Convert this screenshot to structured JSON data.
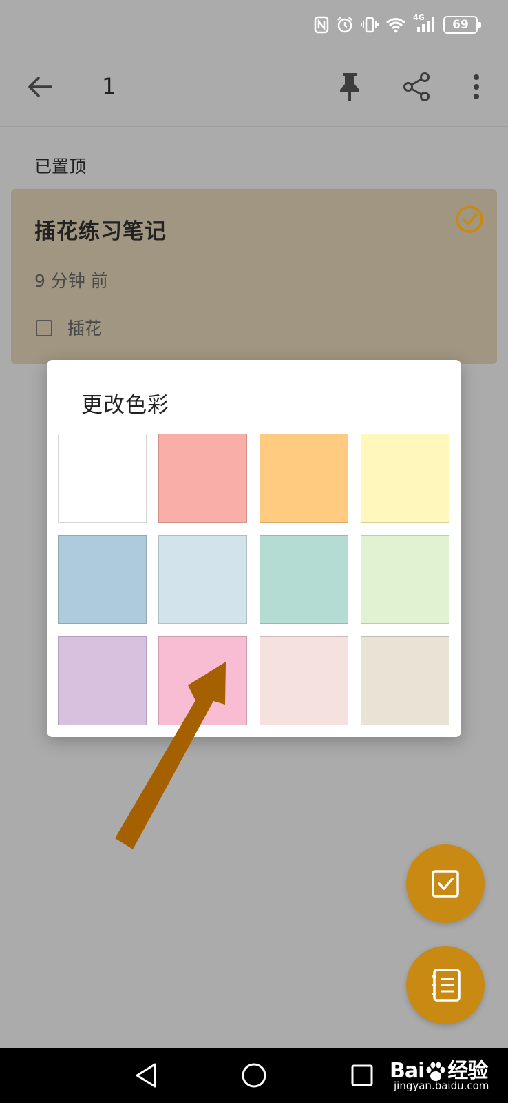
{
  "status_bar": {
    "battery_level": "69",
    "network_type": "4G",
    "icons": [
      "nfc-icon",
      "alarm-icon",
      "vibrate-icon",
      "wifi-icon",
      "signal-icon",
      "battery-icon"
    ]
  },
  "header": {
    "title": "1",
    "icons": [
      "back-arrow-icon",
      "pin-icon",
      "share-icon",
      "more-vertical-icon"
    ]
  },
  "section": {
    "label": "已置顶"
  },
  "note": {
    "title": "插花练习笔记",
    "time": "9 分钟 前",
    "checklist_item": "插花",
    "selected": true,
    "color": "#a09681"
  },
  "color_dialog": {
    "title": "更改色彩",
    "swatches": [
      "#ffffff",
      "#faaea8",
      "#ffcb80",
      "#fff7bb",
      "#aecbdc",
      "#d3e3ec",
      "#b4dcd3",
      "#e1f2d3",
      "#d8c1de",
      "#f8bdd3",
      "#f5e2de",
      "#e9e3d6"
    ]
  },
  "annotation": {
    "arrow_color": "#a56100"
  },
  "fab": {
    "icons": [
      "new-checklist-icon",
      "new-note-icon"
    ],
    "color": "#c98a14"
  },
  "navigation": {
    "icons": [
      "nav-back-icon",
      "nav-home-icon",
      "nav-recent-icon"
    ]
  },
  "watermark": {
    "brand_prefix": "Bai",
    "brand_suffix": "经验",
    "url": "jingyan.baidu.com"
  }
}
